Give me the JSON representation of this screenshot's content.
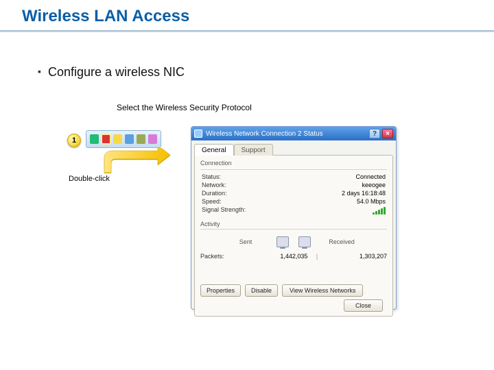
{
  "slide": {
    "title": "Wireless LAN Access",
    "bullet": "Configure a wireless NIC",
    "subcaption": "Select the Wireless Security Protocol",
    "step_number": "1",
    "doubleclick_label": "Double-click"
  },
  "status_window": {
    "title": "Wireless Network Connection 2 Status",
    "tabs": {
      "general": "General",
      "support": "Support"
    },
    "connection_group": "Connection",
    "fields": {
      "status_k": "Status:",
      "status_v": "Connected",
      "network_k": "Network:",
      "network_v": "keeogee",
      "duration_k": "Duration:",
      "duration_v": "2 days 16:18:48",
      "speed_k": "Speed:",
      "speed_v": "54.0 Mbps",
      "signal_k": "Signal Strength:"
    },
    "activity_group": "Activity",
    "activity_labels": {
      "sent": "Sent",
      "sep": "—",
      "received": "Received"
    },
    "packets_label": "Packets:",
    "packets_sent": "1,442,035",
    "packets_sep": "|",
    "packets_received": "1,303,207",
    "buttons": {
      "properties": "Properties",
      "disable": "Disable",
      "view": "View Wireless Networks",
      "close": "Close"
    }
  }
}
